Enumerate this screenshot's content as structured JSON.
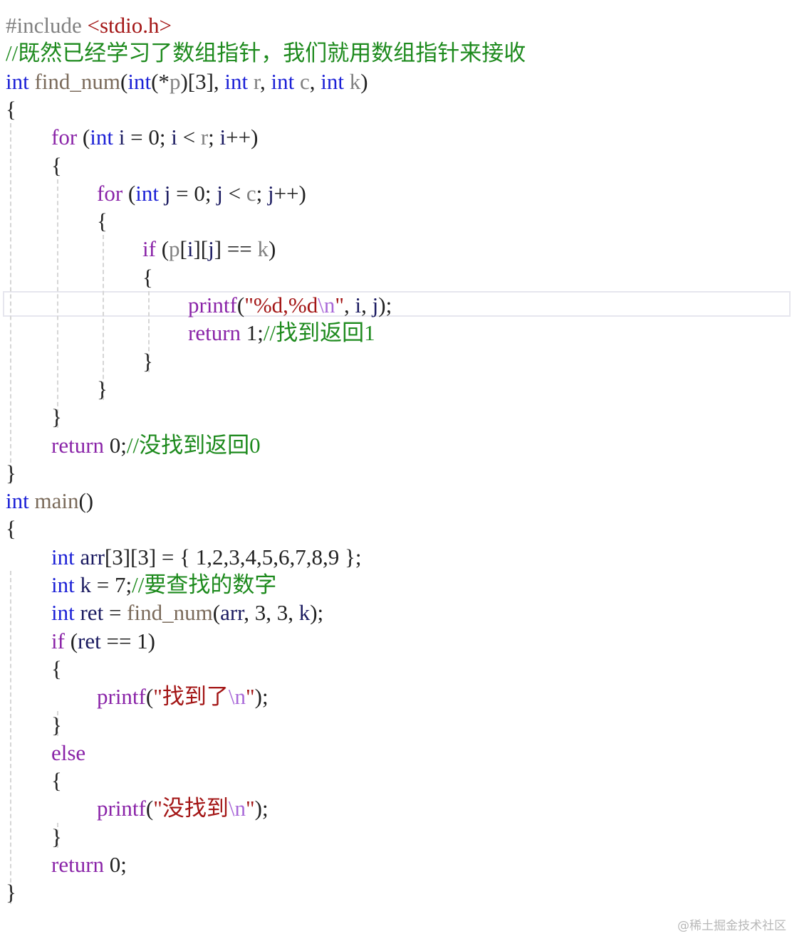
{
  "code": {
    "lines": [
      {
        "indent": 0,
        "tokens": [
          {
            "t": "#include ",
            "k": "pre"
          },
          {
            "t": "<stdio.h>",
            "k": "header"
          }
        ]
      },
      {
        "indent": 0,
        "tokens": [
          {
            "t": "//既然已经学习了数组指针，我们就用数组指针来接收",
            "k": "comment"
          }
        ]
      },
      {
        "indent": 0,
        "tokens": [
          {
            "t": "int",
            "k": "keyword"
          },
          {
            "t": " ",
            "k": "punct"
          },
          {
            "t": "find_num",
            "k": "ident"
          },
          {
            "t": "(",
            "k": "punct"
          },
          {
            "t": "int",
            "k": "keyword"
          },
          {
            "t": "(*",
            "k": "punct"
          },
          {
            "t": "p",
            "k": "param"
          },
          {
            "t": ")[3], ",
            "k": "punct"
          },
          {
            "t": "int",
            "k": "keyword"
          },
          {
            "t": " ",
            "k": "punct"
          },
          {
            "t": "r",
            "k": "param"
          },
          {
            "t": ", ",
            "k": "punct"
          },
          {
            "t": "int",
            "k": "keyword"
          },
          {
            "t": " ",
            "k": "punct"
          },
          {
            "t": "c",
            "k": "param"
          },
          {
            "t": ", ",
            "k": "punct"
          },
          {
            "t": "int",
            "k": "keyword"
          },
          {
            "t": " ",
            "k": "punct"
          },
          {
            "t": "k",
            "k": "param"
          },
          {
            "t": ")",
            "k": "punct"
          }
        ]
      },
      {
        "indent": 0,
        "tokens": [
          {
            "t": "{",
            "k": "punct"
          }
        ]
      },
      {
        "indent": 1,
        "tokens": [
          {
            "t": "for",
            "k": "control"
          },
          {
            "t": " (",
            "k": "punct"
          },
          {
            "t": "int",
            "k": "keyword"
          },
          {
            "t": " ",
            "k": "punct"
          },
          {
            "t": "i",
            "k": "local"
          },
          {
            "t": " = 0; ",
            "k": "punct"
          },
          {
            "t": "i",
            "k": "local"
          },
          {
            "t": " < ",
            "k": "punct"
          },
          {
            "t": "r",
            "k": "param"
          },
          {
            "t": "; ",
            "k": "punct"
          },
          {
            "t": "i",
            "k": "local"
          },
          {
            "t": "++)",
            "k": "punct"
          }
        ]
      },
      {
        "indent": 1,
        "tokens": [
          {
            "t": "{",
            "k": "punct"
          }
        ]
      },
      {
        "indent": 2,
        "tokens": [
          {
            "t": "for",
            "k": "control"
          },
          {
            "t": " (",
            "k": "punct"
          },
          {
            "t": "int",
            "k": "keyword"
          },
          {
            "t": " ",
            "k": "punct"
          },
          {
            "t": "j",
            "k": "local"
          },
          {
            "t": " = 0; ",
            "k": "punct"
          },
          {
            "t": "j",
            "k": "local"
          },
          {
            "t": " < ",
            "k": "punct"
          },
          {
            "t": "c",
            "k": "param"
          },
          {
            "t": "; ",
            "k": "punct"
          },
          {
            "t": "j",
            "k": "local"
          },
          {
            "t": "++)",
            "k": "punct"
          }
        ]
      },
      {
        "indent": 2,
        "tokens": [
          {
            "t": "{",
            "k": "punct"
          }
        ]
      },
      {
        "indent": 3,
        "tokens": [
          {
            "t": "if",
            "k": "control"
          },
          {
            "t": " (",
            "k": "punct"
          },
          {
            "t": "p",
            "k": "param"
          },
          {
            "t": "[",
            "k": "punct"
          },
          {
            "t": "i",
            "k": "local"
          },
          {
            "t": "][",
            "k": "punct"
          },
          {
            "t": "j",
            "k": "local"
          },
          {
            "t": "] == ",
            "k": "punct"
          },
          {
            "t": "k",
            "k": "param"
          },
          {
            "t": ")",
            "k": "punct"
          }
        ]
      },
      {
        "indent": 3,
        "tokens": [
          {
            "t": "{",
            "k": "punct"
          }
        ]
      },
      {
        "indent": 4,
        "tokens": [
          {
            "t": "printf",
            "k": "control"
          },
          {
            "t": "(",
            "k": "punct"
          },
          {
            "t": "\"%d,%d",
            "k": "string"
          },
          {
            "t": "\\n",
            "k": "escape"
          },
          {
            "t": "\"",
            "k": "string"
          },
          {
            "t": ", ",
            "k": "punct"
          },
          {
            "t": "i",
            "k": "local"
          },
          {
            "t": ", ",
            "k": "punct"
          },
          {
            "t": "j",
            "k": "local"
          },
          {
            "t": ");",
            "k": "punct"
          }
        ]
      },
      {
        "indent": 4,
        "tokens": [
          {
            "t": "return",
            "k": "control"
          },
          {
            "t": " 1;",
            "k": "punct"
          },
          {
            "t": "//找到返回1",
            "k": "comment"
          }
        ]
      },
      {
        "indent": 3,
        "tokens": [
          {
            "t": "}",
            "k": "punct"
          }
        ]
      },
      {
        "indent": 2,
        "tokens": [
          {
            "t": "}",
            "k": "punct"
          }
        ]
      },
      {
        "indent": 1,
        "tokens": [
          {
            "t": "}",
            "k": "punct"
          }
        ]
      },
      {
        "indent": 1,
        "tokens": [
          {
            "t": "return",
            "k": "control"
          },
          {
            "t": " 0;",
            "k": "punct"
          },
          {
            "t": "//没找到返回0",
            "k": "comment"
          }
        ]
      },
      {
        "indent": 0,
        "tokens": [
          {
            "t": "}",
            "k": "punct"
          }
        ]
      },
      {
        "indent": 0,
        "tokens": [
          {
            "t": "int",
            "k": "keyword"
          },
          {
            "t": " ",
            "k": "punct"
          },
          {
            "t": "main",
            "k": "ident"
          },
          {
            "t": "()",
            "k": "punct"
          }
        ]
      },
      {
        "indent": 0,
        "tokens": [
          {
            "t": "{",
            "k": "punct"
          }
        ]
      },
      {
        "indent": 1,
        "tokens": [
          {
            "t": "int",
            "k": "keyword"
          },
          {
            "t": " ",
            "k": "punct"
          },
          {
            "t": "arr",
            "k": "local"
          },
          {
            "t": "[3][3] = { 1,2,3,4,5,6,7,8,9 };",
            "k": "punct"
          }
        ]
      },
      {
        "indent": 1,
        "tokens": [
          {
            "t": "int",
            "k": "keyword"
          },
          {
            "t": " ",
            "k": "punct"
          },
          {
            "t": "k",
            "k": "local"
          },
          {
            "t": " = 7;",
            "k": "punct"
          },
          {
            "t": "//要查找的数字",
            "k": "comment"
          }
        ]
      },
      {
        "indent": 1,
        "tokens": [
          {
            "t": "int",
            "k": "keyword"
          },
          {
            "t": " ",
            "k": "punct"
          },
          {
            "t": "ret",
            "k": "local"
          },
          {
            "t": " = ",
            "k": "punct"
          },
          {
            "t": "find_num",
            "k": "ident"
          },
          {
            "t": "(",
            "k": "punct"
          },
          {
            "t": "arr",
            "k": "local"
          },
          {
            "t": ", 3, 3, ",
            "k": "punct"
          },
          {
            "t": "k",
            "k": "local"
          },
          {
            "t": ");",
            "k": "punct"
          }
        ]
      },
      {
        "indent": 1,
        "tokens": [
          {
            "t": "if",
            "k": "control"
          },
          {
            "t": " (",
            "k": "punct"
          },
          {
            "t": "ret",
            "k": "local"
          },
          {
            "t": " == 1)",
            "k": "punct"
          }
        ]
      },
      {
        "indent": 1,
        "tokens": [
          {
            "t": "{",
            "k": "punct"
          }
        ]
      },
      {
        "indent": 2,
        "tokens": [
          {
            "t": "printf",
            "k": "control"
          },
          {
            "t": "(",
            "k": "punct"
          },
          {
            "t": "\"找到了",
            "k": "string"
          },
          {
            "t": "\\n",
            "k": "escape"
          },
          {
            "t": "\"",
            "k": "string"
          },
          {
            "t": ");",
            "k": "punct"
          }
        ]
      },
      {
        "indent": 1,
        "tokens": [
          {
            "t": "}",
            "k": "punct"
          }
        ]
      },
      {
        "indent": 1,
        "tokens": [
          {
            "t": "else",
            "k": "control"
          }
        ]
      },
      {
        "indent": 1,
        "tokens": [
          {
            "t": "{",
            "k": "punct"
          }
        ]
      },
      {
        "indent": 2,
        "tokens": [
          {
            "t": "printf",
            "k": "control"
          },
          {
            "t": "(",
            "k": "punct"
          },
          {
            "t": "\"没找到",
            "k": "string"
          },
          {
            "t": "\\n",
            "k": "escape"
          },
          {
            "t": "\"",
            "k": "string"
          },
          {
            "t": ");",
            "k": "punct"
          }
        ]
      },
      {
        "indent": 1,
        "tokens": [
          {
            "t": "}",
            "k": "punct"
          }
        ]
      },
      {
        "indent": 1,
        "tokens": [
          {
            "t": "return",
            "k": "control"
          },
          {
            "t": " 0;",
            "k": "punct"
          }
        ]
      },
      {
        "indent": 0,
        "tokens": [
          {
            "t": "}",
            "k": "punct"
          }
        ]
      }
    ]
  },
  "watermark": "@稀土掘金技术社区"
}
